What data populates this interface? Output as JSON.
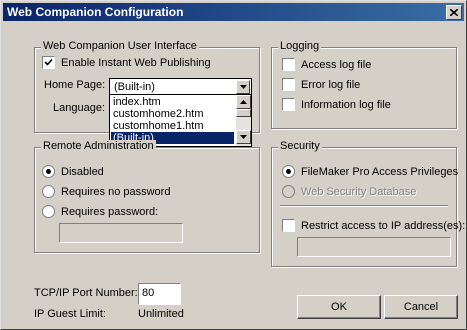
{
  "window": {
    "title": "Web Companion Configuration",
    "close_symbol": "✕"
  },
  "ui_group": {
    "title": "Web Companion User Interface",
    "enable_publishing": {
      "label": "Enable Instant Web Publishing",
      "checked": true
    },
    "home_page": {
      "label": "Home Page:",
      "value": "(Built-in)"
    },
    "language": {
      "label": "Language:"
    },
    "home_page_options": [
      "index.htm",
      "customhome2.htm",
      "customhome1.htm",
      "(Built-in)"
    ],
    "selected_option": "(Built-in)"
  },
  "logging": {
    "title": "Logging",
    "options": [
      {
        "label": "Access log file",
        "checked": false
      },
      {
        "label": "Error log file",
        "checked": false
      },
      {
        "label": "Information log file",
        "checked": false
      }
    ]
  },
  "remote": {
    "title": "Remote Administration",
    "options": [
      {
        "label": "Disabled",
        "selected": true
      },
      {
        "label": "Requires no password",
        "selected": false
      },
      {
        "label": "Requires password:",
        "selected": false
      }
    ],
    "password_value": ""
  },
  "security": {
    "title": "Security",
    "options": [
      {
        "label": "FileMaker Pro Access Privileges",
        "selected": true,
        "enabled": true
      },
      {
        "label": "Web Security Database",
        "selected": false,
        "enabled": false
      }
    ],
    "restrict_ip": {
      "label": "Restrict access to IP address(es):",
      "checked": false,
      "value": ""
    }
  },
  "port": {
    "label": "TCP/IP Port Number:",
    "value": "80"
  },
  "guest_limit": {
    "label": "IP Guest Limit:",
    "value": "Unlimited"
  },
  "buttons": {
    "ok": "OK",
    "cancel": "Cancel"
  },
  "colors": {
    "titlebar_start": "#0a246a",
    "titlebar_end": "#3a6ea5",
    "face": "#d4d0c8",
    "selection": "#0a246a"
  },
  "icons": {
    "close": "close-icon",
    "checkmark": "checkmark-icon",
    "dropdown": "chevron-down-icon",
    "scroll_up": "arrow-up-icon",
    "scroll_down": "arrow-down-icon"
  }
}
